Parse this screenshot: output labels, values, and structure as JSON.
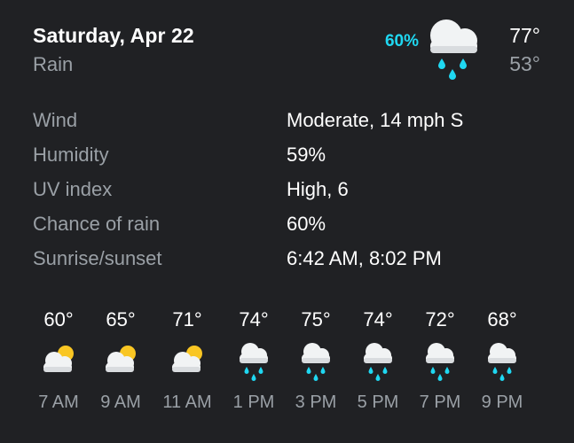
{
  "header": {
    "date": "Saturday, Apr 22",
    "condition": "Rain",
    "precip_chance": "60%",
    "icon": "cloud-rain-icon",
    "temp_high": "77°",
    "temp_low": "53°"
  },
  "details": [
    {
      "label": "Wind",
      "value": "Moderate, 14 mph S"
    },
    {
      "label": "Humidity",
      "value": "59%"
    },
    {
      "label": "UV index",
      "value": "High, 6"
    },
    {
      "label": "Chance of rain",
      "value": "60%"
    },
    {
      "label": "Sunrise/sunset",
      "value": "6:42 AM, 8:02 PM"
    }
  ],
  "hourly": [
    {
      "temp": "60°",
      "time": "7 AM",
      "icon": "partly-cloudy-icon"
    },
    {
      "temp": "65°",
      "time": "9 AM",
      "icon": "partly-cloudy-icon"
    },
    {
      "temp": "71°",
      "time": "11 AM",
      "icon": "partly-cloudy-icon"
    },
    {
      "temp": "74°",
      "time": "1 PM",
      "icon": "cloud-rain-icon"
    },
    {
      "temp": "75°",
      "time": "3 PM",
      "icon": "cloud-rain-icon"
    },
    {
      "temp": "74°",
      "time": "5 PM",
      "icon": "cloud-rain-icon"
    },
    {
      "temp": "72°",
      "time": "7 PM",
      "icon": "cloud-rain-icon"
    },
    {
      "temp": "68°",
      "time": "9 PM",
      "icon": "cloud-rain-icon"
    }
  ],
  "colors": {
    "background": "#202124",
    "accent_precip": "#1fd8f2",
    "sun": "#f9c623",
    "cloud": "#f1f3f4",
    "secondary_text": "#9aa0a6"
  }
}
